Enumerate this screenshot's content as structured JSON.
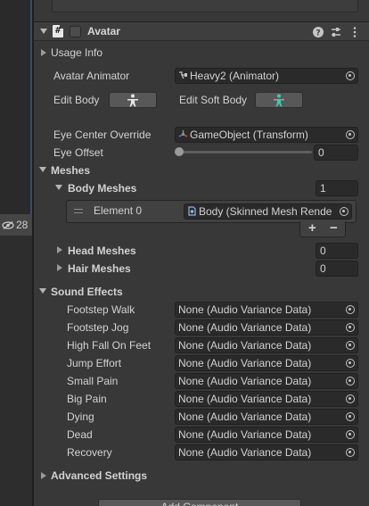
{
  "hierarchy": {
    "visible_count": "28"
  },
  "component": {
    "title": "Avatar"
  },
  "usage_info": {
    "label": "Usage Info"
  },
  "avatar_animator": {
    "label": "Avatar Animator",
    "value": "Heavy2 (Animator)"
  },
  "edit_body": {
    "label": "Edit Body"
  },
  "edit_soft_body": {
    "label": "Edit Soft Body"
  },
  "eye_center_override": {
    "label": "Eye Center Override",
    "value": "GameObject (Transform)"
  },
  "eye_offset": {
    "label": "Eye Offset",
    "value": "0",
    "slider_fraction": 0
  },
  "meshes": {
    "label": "Meshes",
    "body_meshes": {
      "label": "Body Meshes",
      "count": "1",
      "elements": [
        {
          "label": "Element 0",
          "value": "Body (Skinned Mesh Rende"
        }
      ]
    },
    "add_symbol": "+",
    "remove_symbol": "−",
    "head_meshes": {
      "label": "Head Meshes",
      "count": "0"
    },
    "hair_meshes": {
      "label": "Hair Meshes",
      "count": "0"
    }
  },
  "sound_effects": {
    "label": "Sound Effects",
    "items": [
      {
        "label": "Footstep Walk",
        "value": "None (Audio Variance Data)"
      },
      {
        "label": "Footstep Jog",
        "value": "None (Audio Variance Data)"
      },
      {
        "label": "High Fall On Feet",
        "value": "None (Audio Variance Data)"
      },
      {
        "label": "Jump Effort",
        "value": "None (Audio Variance Data)"
      },
      {
        "label": "Small Pain",
        "value": "None (Audio Variance Data)"
      },
      {
        "label": "Big Pain",
        "value": "None (Audio Variance Data)"
      },
      {
        "label": "Dying",
        "value": "None (Audio Variance Data)"
      },
      {
        "label": "Dead",
        "value": "None (Audio Variance Data)"
      },
      {
        "label": "Recovery",
        "value": "None (Audio Variance Data)"
      }
    ]
  },
  "advanced_settings": {
    "label": "Advanced Settings"
  },
  "add_component": {
    "label": "Add Component"
  },
  "colors": {
    "accent_edit_soft_body": "#3fc9b0",
    "selection_blue": "#3a4a73"
  }
}
